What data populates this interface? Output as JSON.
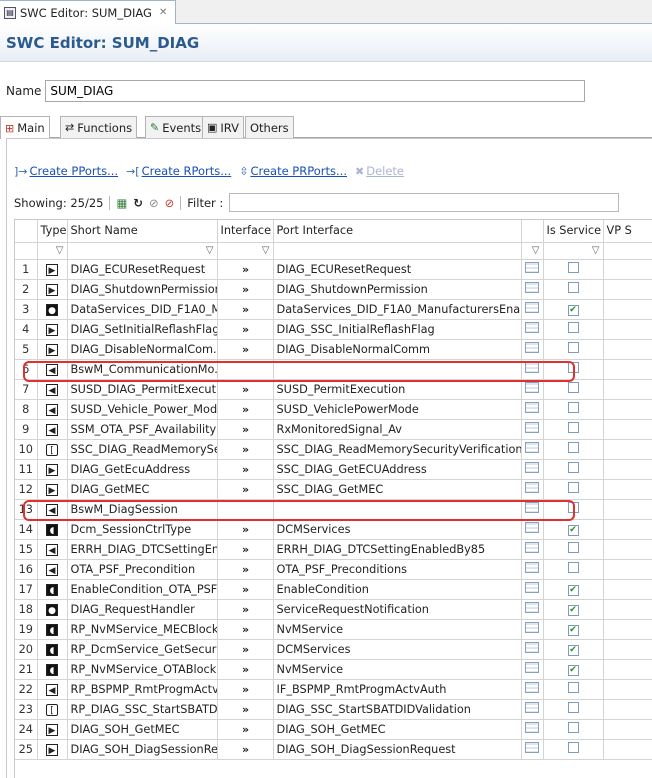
{
  "editor_tab": {
    "title": "SWC Editor: SUM_DIAG",
    "close": "✕"
  },
  "header": {
    "title": "SWC Editor: SUM_DIAG"
  },
  "name_field": {
    "label": "Name",
    "value": "SUM_DIAG"
  },
  "subtabs": [
    "Main",
    "Functions",
    "Events",
    "IRV",
    "Others"
  ],
  "actions": {
    "create_pports": "Create PPorts...",
    "create_rports": "Create RPorts...",
    "create_prports": "Create PRPorts...",
    "delete": "Delete"
  },
  "filterbar": {
    "showing": "Showing: 25/25",
    "filter_label": "Filter :"
  },
  "columns": [
    "Type",
    "Short Name",
    "Interface",
    "Port Interface",
    "",
    "Is Service",
    "VP S"
  ],
  "rows": [
    {
      "n": "1",
      "t": "P",
      "s": "DIAG_ECUResetRequest",
      "i": "»",
      "p": "DIAG_ECUResetRequest",
      "svc": false
    },
    {
      "n": "2",
      "t": "P",
      "s": "DIAG_ShutdownPermission",
      "i": "»",
      "p": "DIAG_ShutdownPermission",
      "svc": false
    },
    {
      "n": "3",
      "t": "O",
      "s": "DataServices_DID_F1A0_M...",
      "i": "»",
      "p": "DataServices_DID_F1A0_ManufacturersEnableC...",
      "svc": true
    },
    {
      "n": "4",
      "t": "P",
      "s": "DIAG_SetInitialReflashFlag",
      "i": "»",
      "p": "DIAG_SSC_InitialReflashFlag",
      "svc": false
    },
    {
      "n": "5",
      "t": "P",
      "s": "DIAG_DisableNormalCom...",
      "i": "»",
      "p": "DIAG_DisableNormalComm",
      "svc": false
    },
    {
      "n": "6",
      "t": "R",
      "s": "BswM_CommunicationMo...",
      "i": "",
      "p": "",
      "svc": false
    },
    {
      "n": "7",
      "t": "R",
      "s": "SUSD_DIAG_PermitExecuti...",
      "i": "»",
      "p": "SUSD_PermitExecution",
      "svc": false
    },
    {
      "n": "8",
      "t": "R",
      "s": "SUSD_Vehicle_Power_Mode",
      "i": "»",
      "p": "SUSD_VehiclePowerMode",
      "svc": false
    },
    {
      "n": "9",
      "t": "R",
      "s": "SSM_OTA_PSF_Availability",
      "i": "»",
      "p": "RxMonitoredSignal_Av",
      "svc": false
    },
    {
      "n": "10",
      "t": "C",
      "s": "SSC_DIAG_ReadMemorySe...",
      "i": "»",
      "p": "SSC_DIAG_ReadMemorySecurityVerification",
      "svc": false
    },
    {
      "n": "11",
      "t": "P",
      "s": "DIAG_GetEcuAddress",
      "i": "»",
      "p": "SSC_DIAG_GetECUAddress",
      "svc": false
    },
    {
      "n": "12",
      "t": "P",
      "s": "DIAG_GetMEC",
      "i": "»",
      "p": "SSC_DIAG_GetMEC",
      "svc": false
    },
    {
      "n": "13",
      "t": "R",
      "s": "BswM_DiagSession",
      "i": "",
      "p": "",
      "svc": false
    },
    {
      "n": "14",
      "t": "D",
      "s": "Dcm_SessionCtrlType",
      "i": "»",
      "p": "DCMServices",
      "svc": true
    },
    {
      "n": "15",
      "t": "R",
      "s": "ERRH_DIAG_DTCSettingEn...",
      "i": "»",
      "p": "ERRH_DIAG_DTCSettingEnabledBy85",
      "svc": false
    },
    {
      "n": "16",
      "t": "R",
      "s": "OTA_PSF_Precondition",
      "i": "»",
      "p": "OTA_PSF_Preconditions",
      "svc": false
    },
    {
      "n": "17",
      "t": "D",
      "s": "EnableCondition_OTA_PSF",
      "i": "»",
      "p": "EnableCondition",
      "svc": true
    },
    {
      "n": "18",
      "t": "O",
      "s": "DIAG_RequestHandler",
      "i": "»",
      "p": "ServiceRequestNotification",
      "svc": true
    },
    {
      "n": "19",
      "t": "D",
      "s": "RP_NvMService_MECBlock",
      "i": "»",
      "p": "NvMService",
      "svc": true
    },
    {
      "n": "20",
      "t": "D",
      "s": "RP_DcmService_GetSecurit...",
      "i": "»",
      "p": "DCMServices",
      "svc": true
    },
    {
      "n": "21",
      "t": "D",
      "s": "RP_NvMService_OTABlock",
      "i": "»",
      "p": "NvMService",
      "svc": true
    },
    {
      "n": "22",
      "t": "R",
      "s": "RP_BSPMP_RmtProgmActv...",
      "i": "»",
      "p": "IF_BSPMP_RmtProgmActvAuth",
      "svc": false
    },
    {
      "n": "23",
      "t": "C",
      "s": "RP_DIAG_SSC_StartSBATDI...",
      "i": "»",
      "p": "DIAG_SSC_StartSBATDIDValidation",
      "svc": false
    },
    {
      "n": "24",
      "t": "P",
      "s": "DIAG_SOH_GetMEC",
      "i": "»",
      "p": "DIAG_SOH_GetMEC",
      "svc": false
    },
    {
      "n": "25",
      "t": "P",
      "s": "DIAG_SOH_DiagSessionRe...",
      "i": "»",
      "p": "DIAG_SOH_DiagSessionRequest",
      "svc": false
    }
  ],
  "colors": {
    "title": "#2a5a8e",
    "highlight": "#e03030",
    "link": "#1a4fb3"
  }
}
